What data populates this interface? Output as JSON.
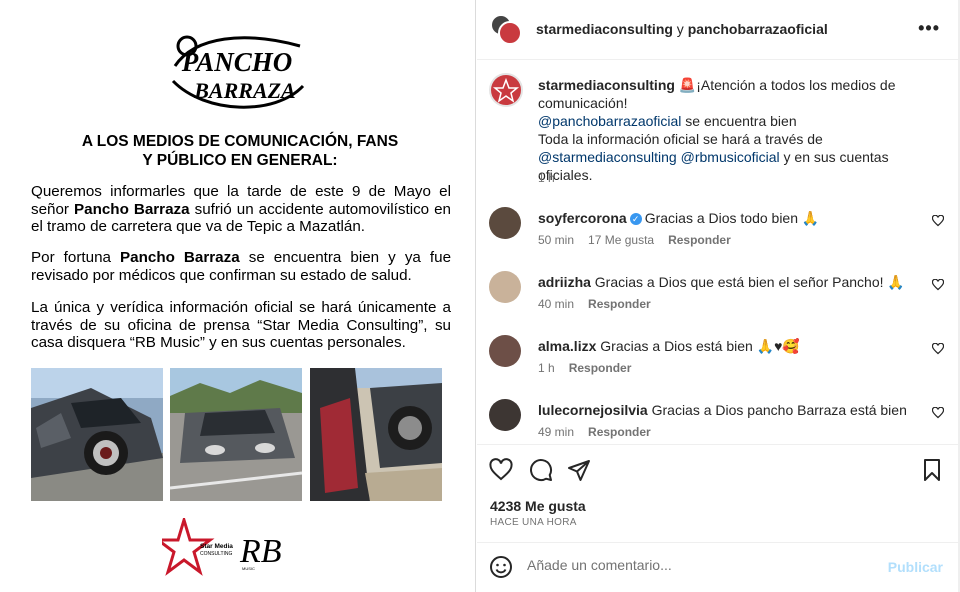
{
  "image": {
    "logo_line1": "PANCHO",
    "logo_line2": "BARRAZA",
    "headline_line1": "A LOS MEDIOS DE COMUNICACIÓN, FANS",
    "headline_line2": "Y PÚBLICO EN GENERAL:",
    "p1_a": "Queremos informarles que la tarde de este 9 de Mayo el señor ",
    "p1_name": "Pancho Barraza",
    "p1_b": " sufrió un accidente automovilístico en el tramo de carretera que va de Tepic a Mazatlán.",
    "p2_a": "Por fortuna ",
    "p2_name": "Pancho Barraza",
    "p2_b": " se encuentra bien y ya fue revisado por médicos que confirman su estado de salud.",
    "p3": "La única y verídica información oficial se hará únicamente a través de su oficina de prensa “Star Media Consulting”, su casa disquera “RB Music” y en sus cuentas personales.",
    "sponsor1_line1": "Star Media",
    "sponsor1_line2": "CONSULTING",
    "sponsor2": "RB",
    "sponsor2_sub": "MUSIC"
  },
  "header": {
    "user1": "starmediaconsulting",
    "joiner": " y ",
    "user2": "panchobarrazaoficial",
    "more_icon": "more-horizontal-icon"
  },
  "caption": {
    "user": "starmediaconsulting",
    "siren": "🚨",
    "line1": "¡Atención a todos los medios de comunicación!",
    "mention1": "@panchobarrazaoficial",
    "line2": " se encuentra bien",
    "line3": "Toda la información oficial se hará a través de",
    "mention2": "@starmediaconsulting",
    "mention3": "@rbmusicoficial",
    "line4": " y en sus cuentas oficiales.",
    "time": "1 h"
  },
  "comments": [
    {
      "user": "soyfercorona",
      "verified": true,
      "text": "Gracias a Dios todo bien 🙏",
      "time": "50 min",
      "likes": "17 Me gusta",
      "reply": "Responder"
    },
    {
      "user": "adriizha",
      "verified": false,
      "text": "Gracias a Dios que está bien el señor Pancho! 🙏",
      "time": "40 min",
      "likes": "",
      "reply": "Responder"
    },
    {
      "user": "alma.lizx",
      "verified": false,
      "text": "Gracias a Dios está bien 🙏♥🥰",
      "time": "1 h",
      "likes": "",
      "reply": "Responder"
    },
    {
      "user": "lulecornejosilvia",
      "verified": false,
      "text": "Gracias a Dios pancho Barraza está bien",
      "time": "49 min",
      "likes": "",
      "reply": "Responder"
    }
  ],
  "actions": {
    "icons": [
      "heart-icon",
      "comment-icon",
      "share-icon",
      "bookmark-icon"
    ],
    "likes": "4238 Me gusta",
    "time": "HACE UNA HORA"
  },
  "comment_bar": {
    "placeholder": "Añade un comentario...",
    "publish": "Publicar"
  },
  "colors": {
    "link": "#00376b",
    "publish_disabled": "#b2dffc",
    "verified": "#3897f0"
  }
}
